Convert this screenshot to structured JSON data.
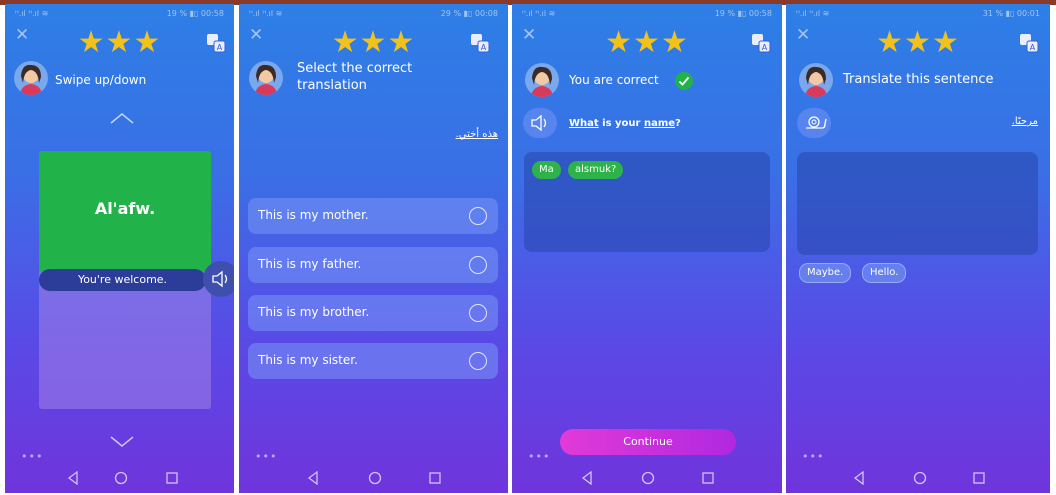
{
  "screens": [
    {
      "status_left": "ᴴ.ıl ᴴ.ıl ≋",
      "status_right": "19 % ▮▯ 00:58",
      "prompt": "Swipe up/down",
      "stars": "★★★",
      "card": {
        "word": "Al'afw.",
        "translation": "You're welcome."
      }
    },
    {
      "status_left": "ᴴ.ıl ᴴ.ıl ≋",
      "status_right": "29 % ▮▯ 00:08",
      "prompt_line1": "Select the correct",
      "prompt_line2": "translation",
      "stars": "★★★",
      "arabic_text": "هذه أختي.",
      "options": [
        "This is my mother.",
        "This is my father.",
        "This is my brother.",
        "This is my sister."
      ]
    },
    {
      "status_left": "ᴴ.ıl ᴴ.ıl ≋",
      "status_right": "19 % ▮▯ 00:58",
      "prompt": "You are correct",
      "stars": "★★★",
      "sentence_part1": "What",
      "sentence_part2": " is your ",
      "sentence_part3": "name",
      "sentence_part4": "?",
      "chips": [
        "Ma",
        "alsmuk?"
      ],
      "continue_label": "Continue"
    },
    {
      "status_left": "ᴴ.ıl ᴴ.ıl ≋",
      "status_right": "31 % ▮▯ 00:01",
      "prompt": "Translate this sentence",
      "stars": "★★★",
      "arabic_text": "مرحبًا.",
      "word_bank": [
        "Maybe.",
        "Hello."
      ]
    }
  ],
  "common": {
    "dots": "•••",
    "close": "✕"
  },
  "colors": {
    "accent_green": "#22b24a",
    "star": "#f2c21a",
    "continue": "#e23ad8"
  },
  "icons": [
    "close-icon",
    "star-icon",
    "translate-icon",
    "speaker-icon",
    "snail-icon",
    "check-icon",
    "chevron-up-icon",
    "chevron-down-icon",
    "back-icon",
    "home-icon",
    "recents-icon"
  ]
}
